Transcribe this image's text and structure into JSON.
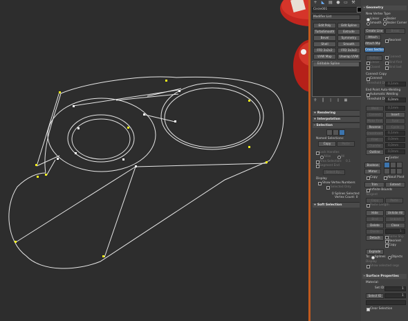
{
  "viewport": {
    "shape_color": "#e8e8e8",
    "vertex_color": "#f2ee1c",
    "selected_vertex_color": "#ffffff",
    "bg_color": "#2d2d2d"
  },
  "toolbar": {
    "icons": [
      "plus-icon",
      "modify-icon",
      "hierarchy-icon",
      "motion-icon",
      "display-icon",
      "utilities-icon"
    ]
  },
  "modifier_panel": {
    "object_name": "Circle001",
    "modifier_list": "Modifier List",
    "color_swatch": "#000000",
    "quick_buttons": [
      "Edit Poly",
      "Edit Spline",
      "TurboSmooth",
      "Extrude",
      "Bevel",
      "Symmetry",
      "Shell",
      "Smooth",
      "FFD 2x2x2",
      "FFD 3x3x3",
      "UVW Map",
      "Unwrap UVW"
    ],
    "stack_item": "Editable Spline",
    "rollouts": {
      "rendering": "Rendering",
      "interpolation": "Interpolation",
      "selection": "Selection",
      "soft_selection": "Soft Selection"
    },
    "named_selections": {
      "label": "Named Selections:",
      "copy": "Copy",
      "paste": "Paste"
    },
    "lock_handles": {
      "label": "Lock Handles",
      "alike": "Alike",
      "all": "All"
    },
    "area_selection": "Area Selection:",
    "area_value": "0,1",
    "segment_end": "Segment End",
    "select_by": "Select By...",
    "display": {
      "label": "Display",
      "show_vertex_numbers": "Show Vertex Numbers",
      "selected_only": "Selected Only"
    },
    "status": [
      "0 Splines Selected",
      "Vertex Count: 0"
    ]
  },
  "geometry_panel": {
    "title": "Geometry",
    "new_vertex_type": "New Vertex Type",
    "radios": [
      "Linear",
      "Bezier",
      "Smooth",
      "Bezier Corner"
    ],
    "create_line": "Create Line",
    "break": "Break",
    "attach": "Attach",
    "reorient": "Reorient",
    "attach_mult": "Attach Mult.",
    "cross_section": "Cross Section",
    "refine_group": [
      "Refine",
      "Connect",
      "Linear",
      "Bind first",
      "Closed",
      "Bind last"
    ],
    "connect_copy": "Connect Copy",
    "connect": "Connect",
    "threshold_distance": "Threshold Dist",
    "threshold_value": "0,1mm",
    "end_point_auto_welding": "End Point Auto-Welding",
    "automatic_welding": "Automatic Welding",
    "threshold_dist": "Threshold Dist",
    "weld_threshold": "6,0mm",
    "op_rows": [
      {
        "a": "Weld",
        "v": "0,1mm"
      },
      {
        "a": "Connect",
        "b": "Insert"
      },
      {
        "a": "Make First",
        "b": "Fuse"
      },
      {
        "a": "Reverse",
        "b": "Cycle"
      },
      {
        "a": "CrossInsert",
        "v": "0,1mm"
      },
      {
        "a": "Fillet",
        "v": "0,0mm"
      },
      {
        "a": "Chamfer",
        "v": "0,0mm"
      },
      {
        "a": "Outline",
        "v": "0,0mm"
      }
    ],
    "center": "Center",
    "boolean": "Boolean",
    "mirror": "Mirror",
    "copy": "Copy",
    "about_pivot": "About Pivot",
    "trim": "Trim",
    "extend": "Extend",
    "infinite_bounds": "Infinite Bounds",
    "tangent": "Tangent",
    "copy2": "Copy",
    "paste": "Paste",
    "paste_length": "Paste Length",
    "hide": "Hide",
    "unhide_all": "Unhide All",
    "bind": "Bind",
    "unbind": "Unbind",
    "delete": "Delete",
    "close": "Close",
    "divide": "Divide",
    "divide_value": "1",
    "detach": "Detach",
    "same_shp": "Same Shp",
    "reorient2": "Reorient",
    "copy3": "Copy",
    "explode": "Explode",
    "to": "To:",
    "splines": "Splines",
    "objects": "Objects",
    "display": "Display",
    "show_selected_segs": "Show selected segs"
  },
  "surface_panel": {
    "title": "Surface Properties",
    "material": "Material:",
    "set_id": "Set ID:",
    "set_id_value": "1",
    "select_id": "Select ID",
    "select_id_value": "1",
    "clear_selection": "Clear Selection"
  }
}
